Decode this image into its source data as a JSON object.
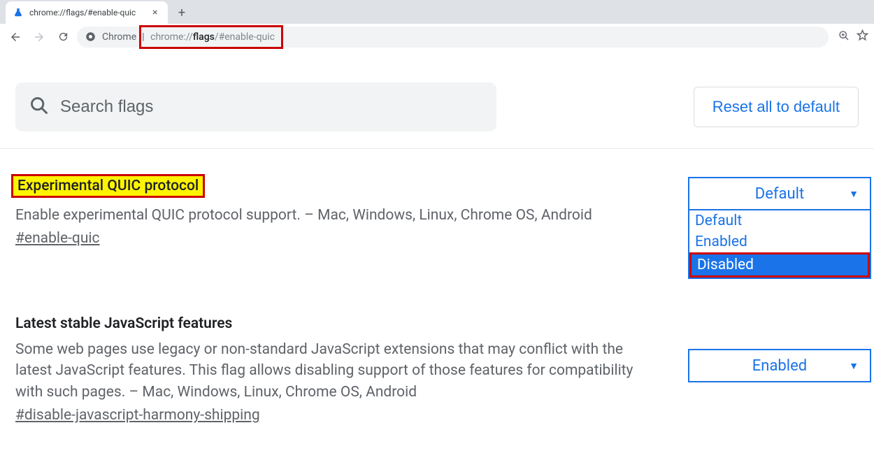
{
  "browser": {
    "tab_title": "chrome://flags/#enable-quic",
    "security_label": "Chrome",
    "url_prefix": "chrome://",
    "url_bold": "flags",
    "url_suffix": "/#enable-quic"
  },
  "search": {
    "placeholder": "Search flags"
  },
  "reset_label": "Reset all to default",
  "flags": [
    {
      "title": "Experimental QUIC protocol",
      "highlight": true,
      "desc": "Enable experimental QUIC protocol support. – Mac, Windows, Linux, Chrome OS, Android",
      "hash": "#enable-quic",
      "selected": "Default",
      "dropdown_open": true,
      "options": [
        "Default",
        "Enabled",
        "Disabled"
      ],
      "dropdown_highlight": "Disabled"
    },
    {
      "title": "Latest stable JavaScript features",
      "highlight": false,
      "desc": "Some web pages use legacy or non-standard JavaScript extensions that may conflict with the latest JavaScript features. This flag allows disabling support of those features for compatibility with such pages. – Mac, Windows, Linux, Chrome OS, Android",
      "hash": "#disable-javascript-harmony-shipping",
      "selected": "Enabled",
      "dropdown_open": false
    }
  ]
}
